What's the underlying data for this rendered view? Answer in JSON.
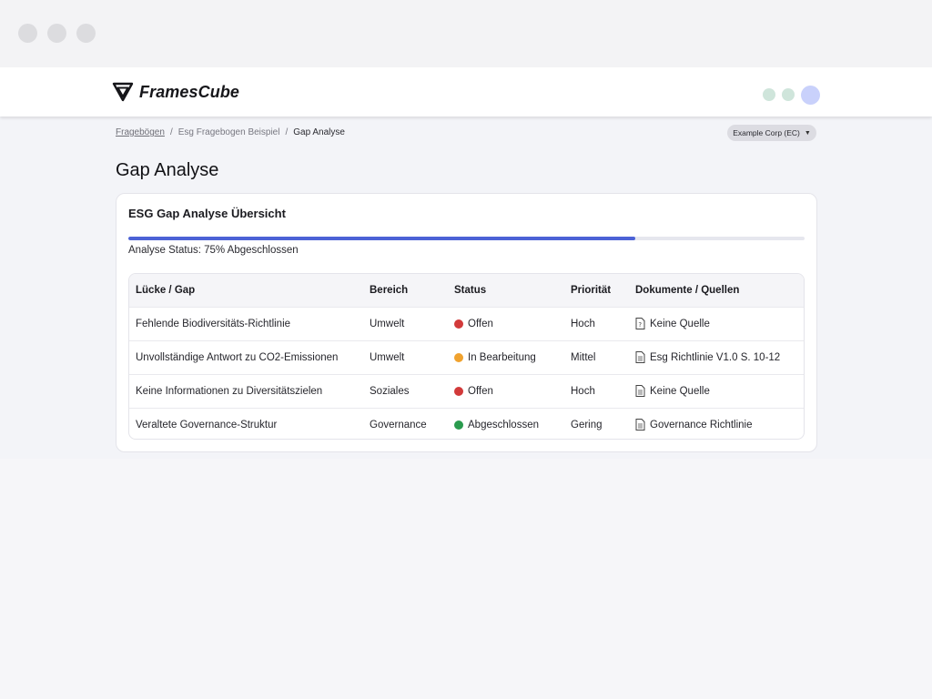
{
  "app": {
    "name": "FramesCube"
  },
  "breadcrumb": [
    {
      "label": "Fragebögen",
      "link": true
    },
    {
      "label": "Esg Fragebogen Beispiel",
      "link": false
    },
    {
      "label": "Gap Analyse",
      "link": false,
      "current": true
    }
  ],
  "breadcrumb_separator": "/",
  "org_selector": {
    "value": "Example Corp (EC)",
    "icon": "caret-down-icon"
  },
  "page_title": "Gap Analyse",
  "card": {
    "title": "ESG Gap Analyse Übersicht",
    "progress": {
      "percent": 75,
      "label": "Analyse Status: 75% Abgeschlossen",
      "color": "#4c62d6"
    }
  },
  "table": {
    "headers": [
      "Lücke / Gap",
      "Bereich",
      "Status",
      "Priorität",
      "Dokumente / Quellen"
    ],
    "rows": [
      {
        "gap": "Fehlende Biodiversitäts-Richtlinie",
        "area": "Umwelt",
        "status": "Offen",
        "status_color": "#d23a3a",
        "priority": "Hoch",
        "doc": "Keine Quelle",
        "doc_icon": "document-missing-icon"
      },
      {
        "gap": "Unvollständige Antwort zu CO2-Emissionen",
        "area": "Umwelt",
        "status": "In Bearbeitung",
        "status_color": "#f0a22e",
        "priority": "Mittel",
        "doc": "Esg Richtlinie V1.0 S. 10-12",
        "doc_icon": "document-icon"
      },
      {
        "gap": "Keine Informationen zu Diversitätszielen",
        "area": "Soziales",
        "status": "Offen",
        "status_color": "#d23a3a",
        "priority": "Hoch",
        "doc": "Keine Quelle",
        "doc_icon": "document-icon"
      },
      {
        "gap": "Veraltete Governance-Struktur",
        "area": "Governance",
        "status": "Abgeschlossen",
        "status_color": "#2a9b4e",
        "priority": "Gering",
        "doc": "Governance Richtlinie",
        "doc_icon": "document-icon"
      }
    ]
  },
  "colors": {
    "accent": "#4c62d6",
    "header_dot_green": "#cfe5db",
    "header_dot_blue": "#c9d1fb"
  }
}
